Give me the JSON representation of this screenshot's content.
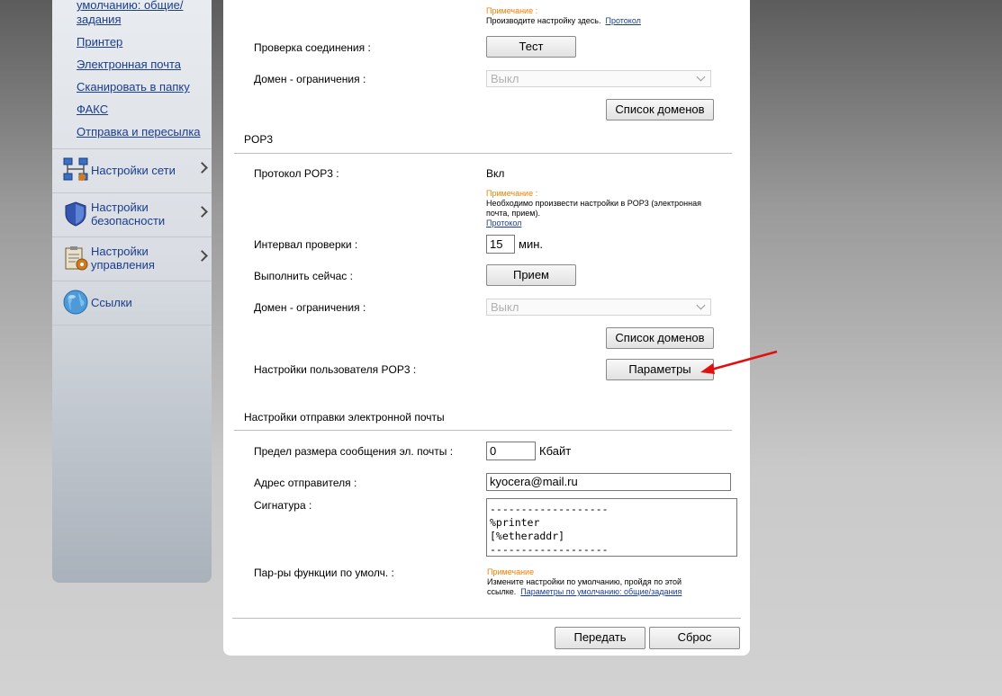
{
  "sidebar": {
    "sub_links": [
      "умолчанию: общие/",
      "задания",
      "Принтер",
      "Электронная почта",
      "Сканировать в папку",
      "ФАКС",
      "Отправка и пересылка"
    ],
    "items": [
      {
        "line1": "Настройки сети",
        "line2": "",
        "icon": "network-icon"
      },
      {
        "line1": "Настройки",
        "line2": "безопасности",
        "icon": "shield-icon"
      },
      {
        "line1": "Настройки",
        "line2": "управления",
        "icon": "clipboard-gear-icon"
      },
      {
        "line1": "Ссылки",
        "line2": "",
        "icon": "globe-icon"
      }
    ]
  },
  "top": {
    "note_title": "Примечание :",
    "note_text": "Производите настройку здесь.",
    "note_link": "Протокол",
    "check_label": "Проверка соединения :",
    "test_button": "Тест",
    "domain_label": "Домен - ограничения :",
    "domain_value": "Выкл",
    "domain_list_button": "Список доменов"
  },
  "pop3": {
    "title": "POP3",
    "protocol_label": "Протокол POP3 :",
    "protocol_value": "Вкл",
    "note_title": "Примечание :",
    "note_line1": "Необходимо произвести настройки в POP3 (электронная",
    "note_line2": "почта, прием).",
    "note_link": "Протокол",
    "interval_label": "Интервал проверки :",
    "interval_value": "15",
    "interval_unit": "мин.",
    "run_now_label": "Выполнить сейчас :",
    "receive_button": "Прием",
    "domain_label": "Домен - ограничения :",
    "domain_value": "Выкл",
    "domain_list_button": "Список доменов",
    "user_settings_label": "Настройки пользователя POP3 :",
    "params_button": "Параметры"
  },
  "send": {
    "title": "Настройки отправки электронной почты",
    "size_label": "Предел размера сообщения эл. почты :",
    "size_value": "0",
    "size_unit": "Кбайт",
    "sender_label": "Адрес отправителя :",
    "sender_value": "kyocera@mail.ru",
    "signature_label": "Сигнатура :",
    "signature_value": "-------------------\n%printer\n[%etheraddr]\n-------------------",
    "defaults_label": "Пар-ры функции по умолч. :",
    "note_title": "Примечание",
    "note_line1": "Измените настройки по умолчанию, пройдя по этой",
    "note_line2": "ссылке.",
    "note_link": "Параметры по умолчанию: общие/задания"
  },
  "footer": {
    "submit_button": "Передать",
    "reset_button": "Сброс"
  },
  "colors": {
    "link": "#1a3d8c",
    "note": "#f08000",
    "arrow": "#e01010"
  }
}
